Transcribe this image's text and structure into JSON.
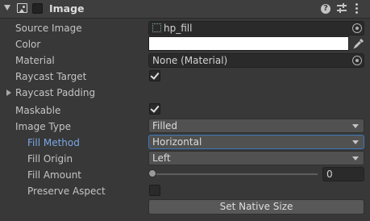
{
  "header": {
    "title": "Image",
    "help_glyph": "?"
  },
  "props": {
    "source_image": {
      "label": "Source Image",
      "value": "hp_fill"
    },
    "color": {
      "label": "Color",
      "value": "#ffffff"
    },
    "material": {
      "label": "Material",
      "value": "None (Material)"
    },
    "raycast_target": {
      "label": "Raycast Target",
      "checked": true
    },
    "raycast_padding": {
      "label": "Raycast Padding",
      "expanded": false
    },
    "maskable": {
      "label": "Maskable",
      "checked": true
    },
    "image_type": {
      "label": "Image Type",
      "value": "Filled"
    },
    "fill_method": {
      "label": "Fill Method",
      "value": "Horizontal"
    },
    "fill_origin": {
      "label": "Fill Origin",
      "value": "Left"
    },
    "fill_amount": {
      "label": "Fill Amount",
      "value": "0",
      "slider_fraction": 0
    },
    "preserve_aspect": {
      "label": "Preserve Aspect",
      "checked": false
    }
  },
  "actions": {
    "set_native_size": "Set Native Size"
  },
  "colors": {
    "background": "#383838",
    "highlight_label": "#7aa7e6",
    "focus_border": "#3a79bb"
  },
  "icons": {
    "foldout": "chevron-down-icon",
    "component": "image-icon",
    "help": "help-icon",
    "presets": "presets-icon",
    "more": "more-vertical-icon",
    "object_picker": "object-picker-icon",
    "eyedropper": "eyedropper-icon"
  }
}
